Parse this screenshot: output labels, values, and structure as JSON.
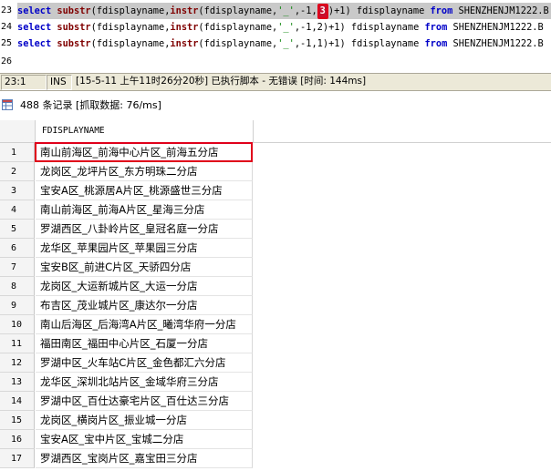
{
  "editor": {
    "lines": [
      {
        "num": "23",
        "selected": true,
        "param": "3"
      },
      {
        "num": "24",
        "selected": false,
        "param": "2"
      },
      {
        "num": "25",
        "selected": false,
        "param": "1"
      },
      {
        "num": "26",
        "selected": false
      }
    ],
    "tokens": {
      "select": "select",
      "substr": "substr",
      "instr": "instr",
      "field": "fdisplayname",
      "alias": "fdisplayname",
      "from": "from",
      "sep": "'_'",
      "neg": "-1",
      "plus1": "+1",
      "table": "SHENZHENJM1222.B"
    },
    "highlight_color": "#c8102e"
  },
  "statusbar": {
    "position": "23:1",
    "mode": "INS",
    "message": "[15-5-11 上午11时26分20秒] 已执行脚本 - 无错误  [时间: 144ms]"
  },
  "results": {
    "record_info": "488 条记录 [抓取数据: 76/ms]",
    "icon": "grid-icon",
    "column": "FDISPLAYNAME",
    "rows": [
      {
        "n": "1",
        "v": "南山前海区_前海中心片区_前海五分店",
        "highlight": true
      },
      {
        "n": "2",
        "v": "龙岗区_龙坪片区_东方明珠二分店"
      },
      {
        "n": "3",
        "v": "宝安A区_桃源居A片区_桃源盛世三分店"
      },
      {
        "n": "4",
        "v": "南山前海区_前海A片区_星海三分店"
      },
      {
        "n": "5",
        "v": "罗湖西区_八卦岭片区_皇冠名庭一分店"
      },
      {
        "n": "6",
        "v": "龙华区_苹果园片区_苹果园三分店"
      },
      {
        "n": "7",
        "v": "宝安B区_前进C片区_天骄四分店"
      },
      {
        "n": "8",
        "v": "龙岗区_大运新城片区_大运一分店"
      },
      {
        "n": "9",
        "v": "布吉区_茂业城片区_康达尔一分店"
      },
      {
        "n": "10",
        "v": "南山后海区_后海湾A片区_曦湾华府一分店"
      },
      {
        "n": "11",
        "v": "福田南区_福田中心片区_石厦一分店"
      },
      {
        "n": "12",
        "v": "罗湖中区_火车站C片区_金色都汇六分店"
      },
      {
        "n": "13",
        "v": "龙华区_深圳北站片区_金域华府三分店"
      },
      {
        "n": "14",
        "v": "罗湖中区_百仕达豪宅片区_百仕达三分店"
      },
      {
        "n": "15",
        "v": "龙岗区_横岗片区_振业城一分店"
      },
      {
        "n": "16",
        "v": "宝安A区_宝中片区_宝城二分店"
      },
      {
        "n": "17",
        "v": "罗湖西区_宝岗片区_嘉宝田三分店"
      }
    ]
  }
}
